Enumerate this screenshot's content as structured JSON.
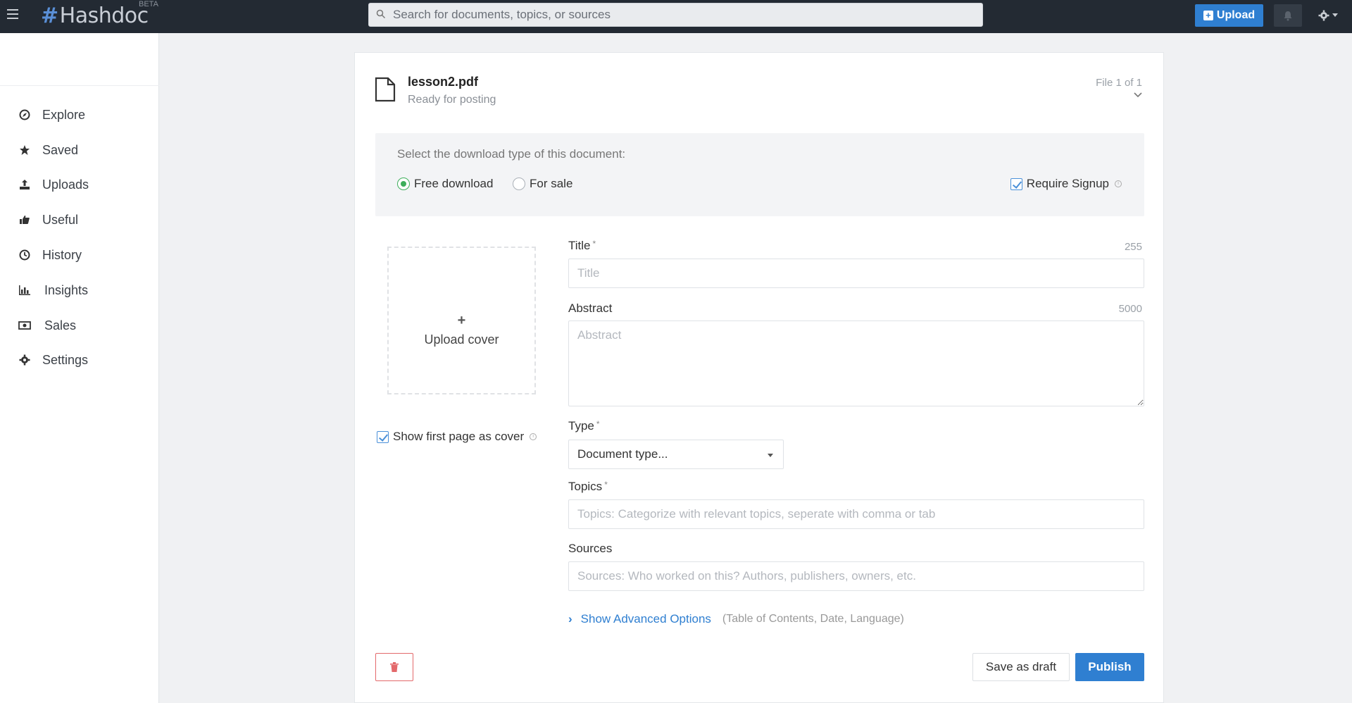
{
  "topbar": {
    "logo": "Hashdoc",
    "logo_hash": "#",
    "beta": "BETA",
    "search_placeholder": "Search for documents, topics, or sources",
    "upload_label": "Upload"
  },
  "sidebar": {
    "items": [
      {
        "label": "Explore",
        "icon": "compass-icon"
      },
      {
        "label": "Saved",
        "icon": "star-icon"
      },
      {
        "label": "Uploads",
        "icon": "upload-icon"
      },
      {
        "label": "Useful",
        "icon": "thumbs-up-icon"
      },
      {
        "label": "History",
        "icon": "clock-icon"
      },
      {
        "label": "Insights",
        "icon": "bar-chart-icon"
      },
      {
        "label": "Sales",
        "icon": "money-icon"
      },
      {
        "label": "Settings",
        "icon": "gear-icon"
      }
    ]
  },
  "file": {
    "name": "lesson2.pdf",
    "status": "Ready for posting",
    "count": "File 1 of 1"
  },
  "download": {
    "prompt": "Select the download type of this document:",
    "options": [
      "Free download",
      "For sale"
    ],
    "selected": "Free download",
    "require_signup": "Require Signup",
    "require_signup_checked": true
  },
  "cover": {
    "plus": "+",
    "label": "Upload cover",
    "first_page_label": "Show first page as cover",
    "first_page_checked": true
  },
  "form": {
    "title_label": "Title",
    "title_limit": "255",
    "title_placeholder": "Title",
    "abstract_label": "Abstract",
    "abstract_limit": "5000",
    "abstract_placeholder": "Abstract",
    "type_label": "Type",
    "type_value": "Document type...",
    "topics_label": "Topics",
    "topics_placeholder": "Topics: Categorize with relevant topics, seperate with comma or tab",
    "sources_label": "Sources",
    "sources_placeholder": "Sources: Who worked on this? Authors, publishers, owners, etc.",
    "required_mark": "*"
  },
  "advanced": {
    "link": "Show Advanced Options",
    "hint": "(Table of Contents, Date, Language)"
  },
  "actions": {
    "save_draft": "Save as draft",
    "publish": "Publish"
  },
  "colors": {
    "topbar": "#232a33",
    "accent": "#2f7fd1",
    "radio_on": "#3dae5a",
    "delete": "#e3696b"
  }
}
